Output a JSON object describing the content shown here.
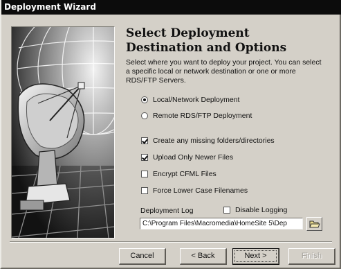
{
  "window": {
    "title": "Deployment Wizard"
  },
  "header": {
    "title": "Select Deployment Destination and Options",
    "description": "Select where you want to deploy your project. You can select a specific local or network destination or one or more RDS/FTP Servers."
  },
  "destination": {
    "options": [
      {
        "label": "Local/Network Deployment",
        "selected": true
      },
      {
        "label": "Remote RDS/FTP Deployment",
        "selected": false
      }
    ]
  },
  "settings": {
    "options": [
      {
        "label": "Create any missing folders/directories",
        "checked": true
      },
      {
        "label": "Upload Only Newer Files",
        "checked": true
      },
      {
        "label": "Encrypt CFML Files",
        "checked": false
      },
      {
        "label": "Force Lower Case Filenames",
        "checked": false
      }
    ]
  },
  "log": {
    "label": "Deployment Log",
    "disable_label": "Disable Logging",
    "disable_checked": false,
    "path": "C:\\Program Files\\Macromedia\\HomeSite 5\\Dep"
  },
  "buttons": {
    "cancel": "Cancel",
    "back": "< Back",
    "next": "Next >",
    "finish": "Finish"
  },
  "icons": {
    "browse": "folder-open-icon",
    "art": "satellite-dish-illustration"
  }
}
